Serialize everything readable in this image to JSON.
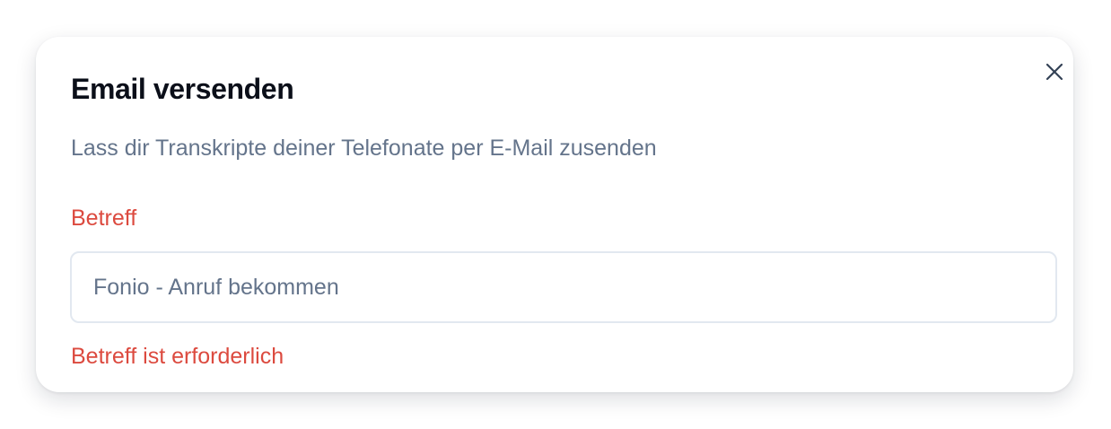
{
  "dialog": {
    "title": "Email versenden",
    "description": "Lass dir Transkripte deiner Telefonate per E-Mail zusenden",
    "close_icon": "close-icon"
  },
  "subject_field": {
    "label": "Betreff",
    "value": "",
    "placeholder": "Fonio - Anruf bekommen",
    "error": "Betreff ist erforderlich"
  },
  "colors": {
    "error": "#dc4a3f",
    "muted_text": "#64748b",
    "title_text": "#0b0f19",
    "input_border": "#e2e8f0"
  }
}
